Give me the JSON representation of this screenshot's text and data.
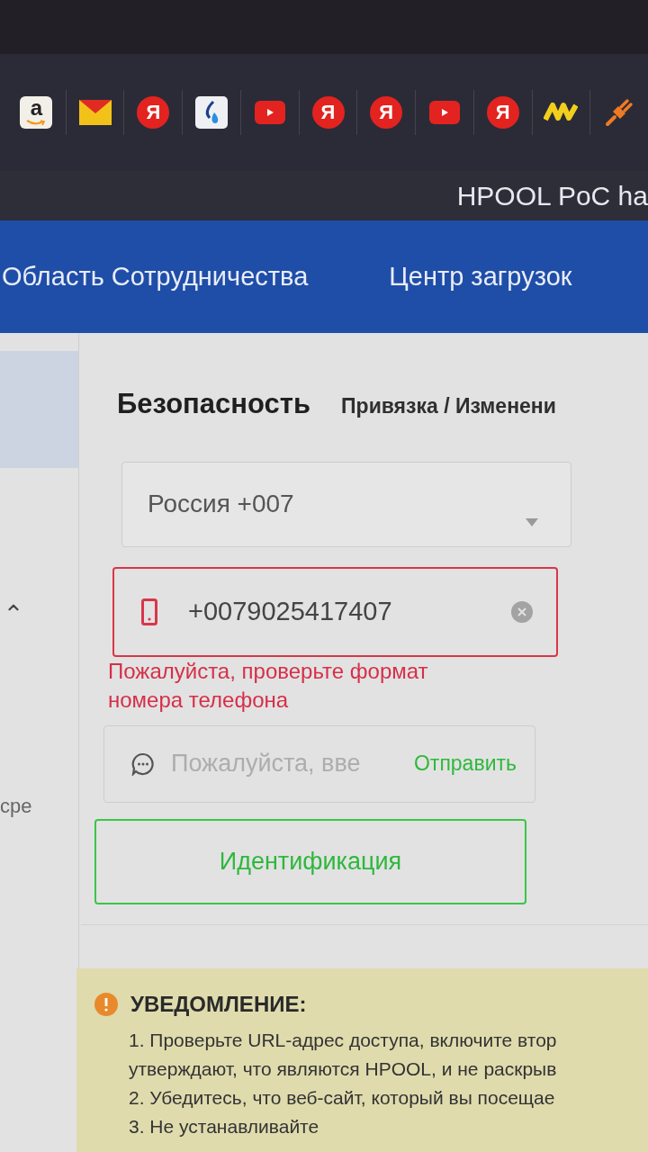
{
  "bookmarks": [
    {
      "kind": "tile-letter",
      "glyph": "a"
    },
    {
      "kind": "envelope"
    },
    {
      "kind": "circle-letter",
      "glyph": "Я"
    },
    {
      "kind": "drop"
    },
    {
      "kind": "play"
    },
    {
      "kind": "circle-letter",
      "glyph": "Я"
    },
    {
      "kind": "circle-letter",
      "glyph": "Я"
    },
    {
      "kind": "play"
    },
    {
      "kind": "circle-letter",
      "glyph": "Я"
    },
    {
      "kind": "zigzag"
    },
    {
      "kind": "plug"
    }
  ],
  "header": {
    "title": "HPOOL PoC ha"
  },
  "nav": [
    {
      "label": "Область Сотрудничества"
    },
    {
      "label": "Центр загрузок"
    }
  ],
  "sidebar": {
    "items": [
      {
        "kind": "item",
        "selected": true
      },
      {
        "kind": "group",
        "expanded": true
      },
      {
        "kind": "item",
        "label": "сре",
        "selected": false
      }
    ]
  },
  "tabs": [
    {
      "label": "Безопасность",
      "selected": true
    },
    {
      "label": "Привязка / Изменени",
      "selected": false
    }
  ],
  "form": {
    "country": {
      "value": "Россия +007"
    },
    "phone": {
      "value": "+0079025417407",
      "invalid": true,
      "error": "Пожалуйста, проверьте формат номера телефона"
    },
    "code": {
      "placeholder": "Пожалуйста, вве",
      "action": "Отправить"
    },
    "submit": "Идентификация"
  },
  "notice": {
    "title": "УВЕДОМЛЕНИЕ:",
    "lines": [
      "1. Проверьте URL-адрес доступа, включите втор",
      "утверждают, что являются HPOOL, и не раскрыв",
      "2. Убедитесь, что веб-сайт, который вы посещае",
      "3. Не устанавливайте"
    ]
  }
}
